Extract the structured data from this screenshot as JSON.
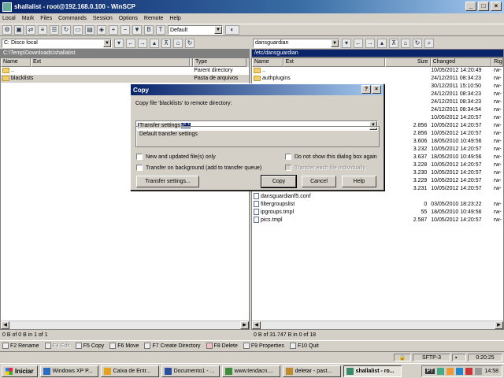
{
  "window": {
    "title": "shallalist - root@192.168.0.100 - WinSCP",
    "controls": [
      "_",
      "□",
      "×"
    ]
  },
  "menu": [
    "Local",
    "Mark",
    "Files",
    "Commands",
    "Session",
    "Options",
    "Remote",
    "Help"
  ],
  "toolbar": {
    "transfer_preset": "Default"
  },
  "left": {
    "drive": "C: Disco local",
    "path": "C:\\Temp\\Downloads\\shallalist",
    "columns": {
      "name": "Name",
      "ext": "Ext",
      "size": "Size",
      "type": "Type"
    },
    "rows": [
      {
        "name": "..",
        "size": "",
        "type": "Parent directory",
        "icon": "parent"
      },
      {
        "name": "blacklists",
        "size": "",
        "type": "Pasta de arquivos",
        "icon": "folder"
      }
    ],
    "status": "0 B of 0 B in 1 of 1"
  },
  "right": {
    "drive": "dansguardian",
    "path": "/etc/dansguardian",
    "columns": {
      "name": "Name",
      "ext": "Ext",
      "size": "Size",
      "changed": "Changed",
      "rights": "Rig"
    },
    "rows": [
      {
        "name": "..",
        "size": "",
        "changed": "10/05/2012 14:20:49",
        "rights": "rw-",
        "icon": "parent"
      },
      {
        "name": "authplugins",
        "size": "",
        "changed": "24/12/2011 08:34:23",
        "rights": "rw-",
        "icon": "folder"
      },
      {
        "name": "",
        "size": "",
        "changed": "30/12/2011 15:10:50",
        "rights": "rw-",
        "icon": "none"
      },
      {
        "name": "",
        "size": "",
        "changed": "24/12/2011 08:34:23",
        "rights": "rw-",
        "icon": "none"
      },
      {
        "name": "",
        "size": "",
        "changed": "24/12/2011 08:34:23",
        "rights": "rw-",
        "icon": "none"
      },
      {
        "name": "",
        "size": "",
        "changed": "24/12/2011 08:34:54",
        "rights": "rw-",
        "icon": "none"
      },
      {
        "name": "",
        "size": "",
        "changed": "10/05/2012 14:20:57",
        "rights": "rw-",
        "icon": "none"
      },
      {
        "name": "",
        "size": "2.856",
        "changed": "10/05/2012 14:20:57",
        "rights": "rw-",
        "icon": "none"
      },
      {
        "name": "",
        "size": "2.856",
        "changed": "10/05/2012 14:20:57",
        "rights": "rw-",
        "icon": "none"
      },
      {
        "name": "",
        "size": "3.606",
        "changed": "18/05/2010 10:49:56",
        "rights": "rw-",
        "icon": "none"
      },
      {
        "name": "",
        "size": "3.232",
        "changed": "10/05/2012 14:20:57",
        "rights": "rw-",
        "icon": "none"
      },
      {
        "name": "",
        "size": "3.637",
        "changed": "18/05/2010 10:49:56",
        "rights": "rw-",
        "icon": "none"
      },
      {
        "name": "",
        "size": "3.228",
        "changed": "10/05/2012 14:20:57",
        "rights": "rw-",
        "icon": "none"
      },
      {
        "name": "",
        "size": "3.230",
        "changed": "10/05/2012 14:20:57",
        "rights": "rw-",
        "icon": "none"
      },
      {
        "name": "",
        "size": "3.229",
        "changed": "10/05/2012 14:20:57",
        "rights": "rw-",
        "icon": "none"
      },
      {
        "name": "",
        "size": "3.231",
        "changed": "10/05/2012 14:20:57",
        "rights": "rw-",
        "icon": "none"
      },
      {
        "name": "dansguardianf5.conf",
        "size": "",
        "changed": "",
        "rights": "",
        "icon": "doc"
      },
      {
        "name": "filtergroupslist",
        "size": "0",
        "changed": "03/05/2010 18:23:22",
        "rights": "rw-",
        "icon": "doc"
      },
      {
        "name": "ipgroups.tmpl",
        "size": "55",
        "changed": "18/05/2010 10:49:56",
        "rights": "rw-",
        "icon": "doc"
      },
      {
        "name": "pics.tmpl",
        "size": "2.587",
        "changed": "10/05/2012 14:20:57",
        "rights": "rw-",
        "icon": "doc"
      }
    ],
    "status": "0 B of 31.747 B in 0 of 18"
  },
  "fnkeys": [
    "F2 Rename",
    "F4 Edit",
    "F5 Copy",
    "F6 Move",
    "F7 Create Directory",
    "F8 Delete",
    "F9 Properties",
    "F10 Quit"
  ],
  "statusbar": {
    "protocol": "SFTP-3",
    "elapsed": "0:20:25"
  },
  "dialog": {
    "title": "Copy",
    "help_btn": "?",
    "close_btn": "×",
    "prompt": "Copy file 'blacklists' to remote directory:",
    "target": "/etc/dansguardian/*.*",
    "settings_group": "Transfer settings",
    "settings_text": "Default transfer settings",
    "opt_new_only": "New and updated file(s) only",
    "opt_background": "Transfer on background (add to transfer queue)",
    "opt_dont_show": "Do not show this dialog box again",
    "opt_each_file": "Transfer each file individually",
    "btn_transfer_settings": "Transfer settings...",
    "btn_copy": "Copy",
    "btn_cancel": "Cancel",
    "btn_help": "Help"
  },
  "taskbar": {
    "start": "Iniciar",
    "tasks": [
      {
        "label": "Windows XP P...",
        "color": "#2b6cc4",
        "active": false
      },
      {
        "label": "Caixa de Entr...",
        "color": "#e8a020",
        "active": false
      },
      {
        "label": "Documento1 - ...",
        "color": "#2a4fa0",
        "active": false
      },
      {
        "label": "www.tendacn....",
        "color": "#3c8c3c",
        "active": false
      },
      {
        "label": "deletar - past...",
        "color": "#c08a2a",
        "active": false
      },
      {
        "label": "shallalist - ro...",
        "color": "#3a8a6a",
        "active": true
      }
    ],
    "lang": "PT",
    "clock": "14:58"
  }
}
